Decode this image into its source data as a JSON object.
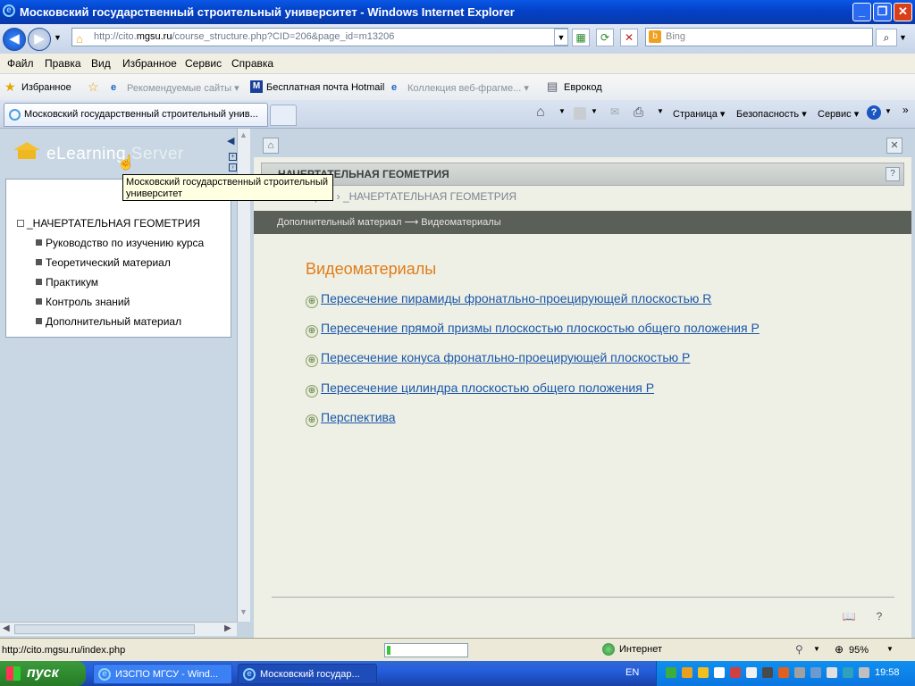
{
  "window": {
    "title": "Московский государственный строительный университет - Windows Internet Explorer"
  },
  "addressbar": {
    "url_prefix": "http://cito.",
    "url_host": "mgsu.ru",
    "url_rest": "/course_structure.php?CID=206&page_id=m13206",
    "search_placeholder": "Bing"
  },
  "menu": [
    "Файл",
    "Правка",
    "Вид",
    "Избранное",
    "Сервис",
    "Справка"
  ],
  "favorites_bar": {
    "favorites_label": "Избранное",
    "items": [
      "Рекомендуемые сайты ▾",
      "Бесплатная почта Hotmail",
      "Коллекция веб-фрагме... ▾",
      "Еврокод"
    ]
  },
  "tabs": [
    {
      "label": "Московский государственный строительный унив..."
    }
  ],
  "command_bar": [
    "Страница ▾",
    "Безопасность ▾",
    "Сервис ▾"
  ],
  "left_pane": {
    "logo_text_1": "eLearning",
    "logo_text_2": " Server",
    "tooltip": "Московский государственный строительный университет",
    "tree": {
      "root": "_НАЧЕРТАТЕЛЬНАЯ ГЕОМЕТРИЯ",
      "items": [
        "Руководство по изучению курса",
        "Теоретический материал",
        "Практикум",
        "Контроль знаний",
        "Дополнительный материал"
      ]
    }
  },
  "course": {
    "header": "НАЧЕРТАТЕЛЬНАЯ ГЕОМЕТРИЯ",
    "breadcrumb_tail": "рсы › _НАЧЕРТАТЕЛЬНАЯ ГЕОМЕТРИЯ",
    "path": "Дополнительный материал ⟶ Видеоматериалы",
    "page_title": "Видеоматериалы",
    "links": [
      "Пересечение пирамиды фронатльно-проецирующей плоскостью R",
      "Пересечение прямой призмы плоскостью плоскостью общего положения P",
      "Пересечение конуса фронатльно-проецирующей плоскостью P",
      "Пересечение цилиндра плоскостью общего положения P",
      "Перспектива"
    ]
  },
  "statusbar": {
    "url": "http://cito.mgsu.ru/index.php",
    "progress": 0.05,
    "zone": "Интернет",
    "zoom": "95%"
  },
  "taskbar": {
    "start": "пуск",
    "tasks": [
      "ИЗСПО МГСУ - Wind...",
      "Московский государ..."
    ],
    "lang": "EN",
    "clock": "19:58"
  },
  "colors": {
    "accent_title": "#e07c18",
    "link": "#1b56a8",
    "titlebar": "#0a58e6"
  }
}
